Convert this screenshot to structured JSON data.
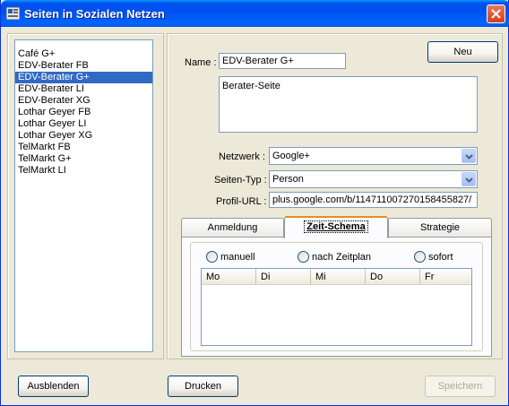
{
  "window": {
    "title": "Seiten in Sozialen Netzen"
  },
  "list": {
    "items": [
      "Café G+",
      "EDV-Berater FB",
      "EDV-Berater G+",
      "EDV-Berater LI",
      "EDV-Berater XG",
      "Lothar Geyer FB",
      "Lothar Geyer LI",
      "Lothar Geyer XG",
      "TelMarkt FB",
      "TelMarkt G+",
      "TelMarkt LI"
    ],
    "selected": "EDV-Berater G+"
  },
  "form": {
    "name_label": "Name :",
    "name_value": "EDV-Berater G+",
    "description_value": "Berater-Seite",
    "netzwerk_label": "Netzwerk :",
    "netzwerk_value": "Google+",
    "seitentyp_label": "Seiten-Typ :",
    "seitentyp_value": "Person",
    "profilurl_label": "Profil-URL :",
    "profilurl_value": "plus.google.com/b/114711007270158455827/",
    "new_button": "Neu"
  },
  "tabs": {
    "items": [
      "Anmeldung",
      "Zeit-Schema",
      "Strategie"
    ],
    "active": "Zeit-Schema"
  },
  "schedule": {
    "radios": [
      "manuell",
      "nach Zeitplan",
      "sofort"
    ],
    "columns": [
      "Mo",
      "Di",
      "Mi",
      "Do",
      "Fr"
    ]
  },
  "footer": {
    "hide_button": "Ausblenden",
    "print_button": "Drucken",
    "save_button": "Speichern"
  },
  "colors": {
    "titlebar": "#0054e3",
    "selection": "#316ac5",
    "active_tab_accent": "#e68b2c"
  }
}
